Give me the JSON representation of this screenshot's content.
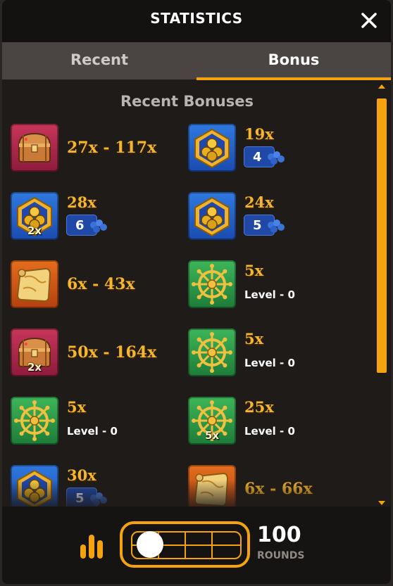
{
  "header": {
    "title": "STATISTICS",
    "close_icon": "close-icon"
  },
  "tabs": [
    {
      "label": "Recent",
      "active": false
    },
    {
      "label": "Bonus",
      "active": true
    }
  ],
  "section_title": "Recent Bonuses",
  "bonuses": [
    {
      "icon": "treasure-chest-icon",
      "color": "red",
      "badge": "",
      "range": "27x - 117x"
    },
    {
      "icon": "cannonballs-icon",
      "color": "blue",
      "badge": "",
      "value": "19x",
      "count": "4"
    },
    {
      "icon": "cannonballs-icon",
      "color": "blue",
      "badge": "2x",
      "value": "28x",
      "count": "6"
    },
    {
      "icon": "cannonballs-icon",
      "color": "blue",
      "badge": "",
      "value": "24x",
      "count": "5"
    },
    {
      "icon": "map-scroll-icon",
      "color": "orange",
      "badge": "",
      "range": "6x - 43x"
    },
    {
      "icon": "ship-wheel-icon",
      "color": "green",
      "badge": "",
      "value": "5x",
      "level": "Level - 0"
    },
    {
      "icon": "treasure-chest-icon",
      "color": "red",
      "badge": "2x",
      "range": "50x - 164x"
    },
    {
      "icon": "ship-wheel-icon",
      "color": "green",
      "badge": "",
      "value": "5x",
      "level": "Level - 0"
    },
    {
      "icon": "ship-wheel-icon",
      "color": "green",
      "badge": "",
      "value": "5x",
      "level": "Level - 0"
    },
    {
      "icon": "ship-wheel-icon",
      "color": "green",
      "badge": "5x",
      "value": "25x",
      "level": "Level - 0"
    },
    {
      "icon": "cannonballs-icon",
      "color": "blue",
      "badge": "",
      "value": "30x",
      "count": "5"
    },
    {
      "icon": "map-scroll-icon",
      "color": "orange",
      "badge": "",
      "range": "6x - 66x"
    }
  ],
  "footer": {
    "rounds_value": "100",
    "rounds_label": "ROUNDS",
    "slider_position": 0
  },
  "colors": {
    "accent": "#f4a20e",
    "gold_text": "#f5b52d"
  }
}
